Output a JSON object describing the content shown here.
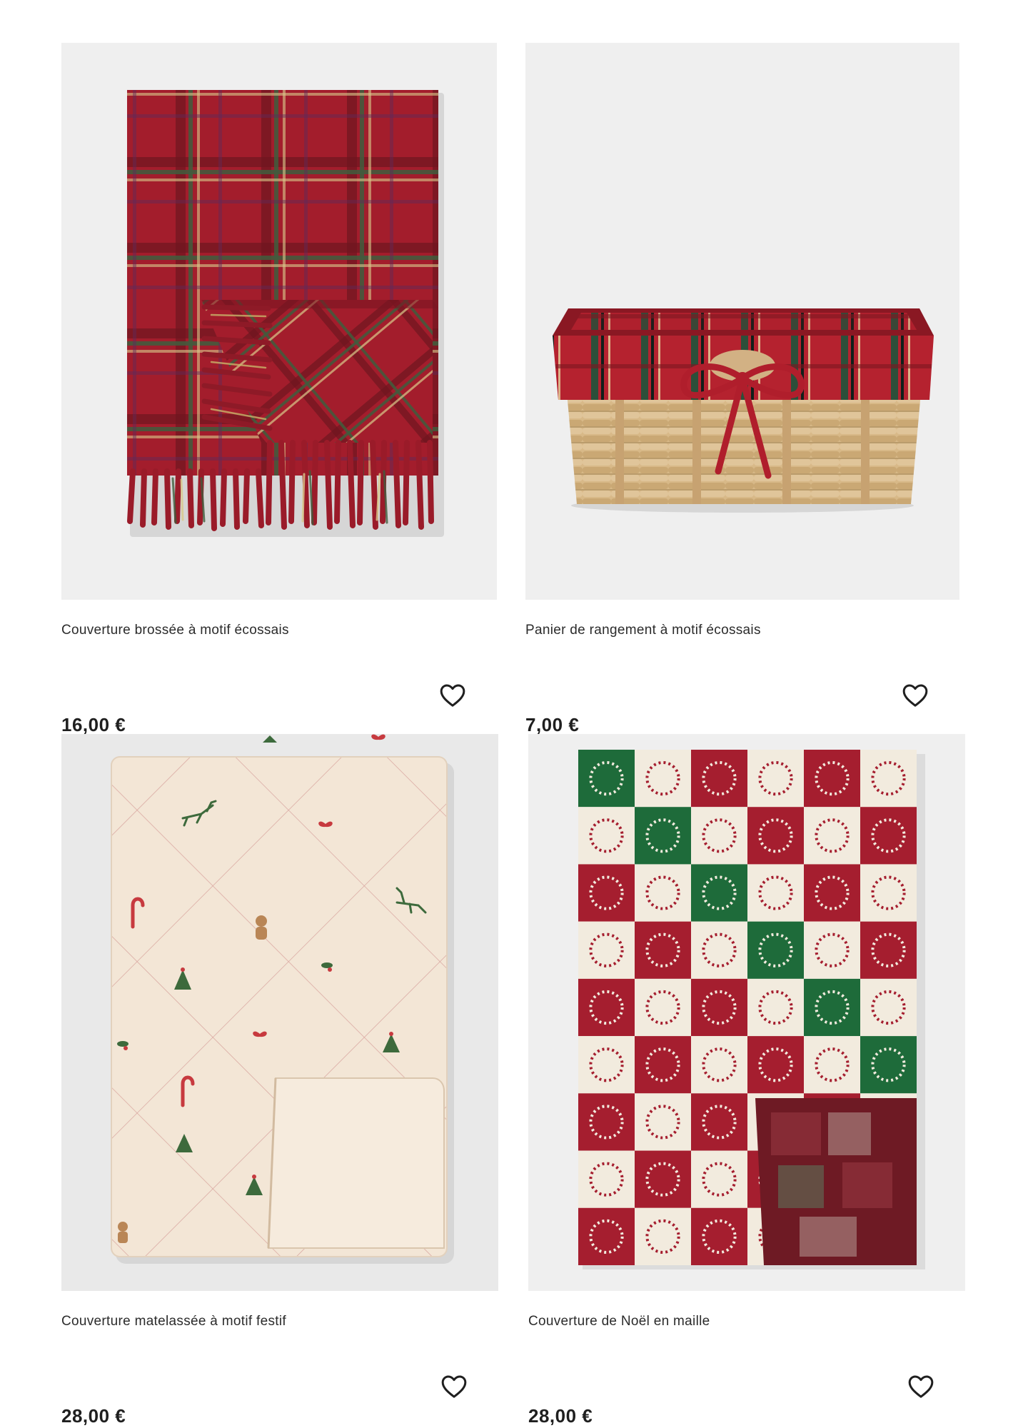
{
  "products": [
    {
      "title": "Couverture brossée à motif écossais",
      "price": "16,00 €",
      "image_icon": "plaid-throw-blanket-image"
    },
    {
      "title": "Panier de rangement à motif écossais",
      "price": "7,00 €",
      "image_icon": "storage-basket-image"
    },
    {
      "title": "Couverture matelassée à motif festif",
      "price": "28,00 €",
      "image_icon": "quilted-festive-blanket-image"
    },
    {
      "title": "Couverture de Noël en maille",
      "price": "28,00 €",
      "image_icon": "knitted-christmas-blanket-image"
    }
  ],
  "wishlist_icon": "heart-outline-icon",
  "colors": {
    "image_background": "#efefef",
    "plaid_red": "#9e1b2a",
    "plaid_green": "#3c5a3a",
    "basket_straw": "#d2b184",
    "quilt_cream": "#f3e6d6",
    "knit_red": "#a51e2f",
    "knit_green": "#1e6b3a",
    "knit_cream": "#f2ebde",
    "text": "#1f1f1f"
  }
}
